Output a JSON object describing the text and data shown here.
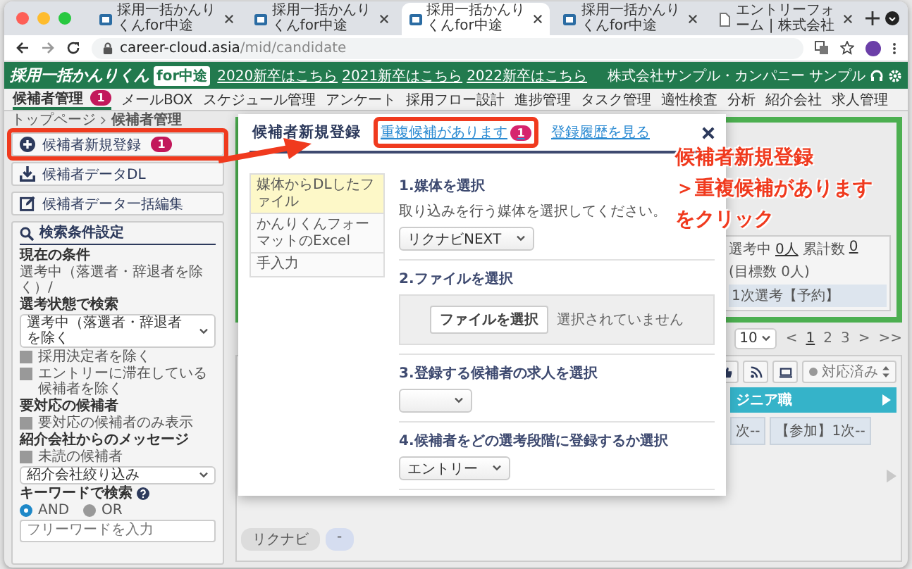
{
  "browser": {
    "tabs": [
      {
        "title": "採用一括かんりくんfor中途",
        "kind": "app",
        "selected": false
      },
      {
        "title": "採用一括かんりくんfor中途",
        "kind": "app",
        "selected": false
      },
      {
        "title": "採用一括かんりくんfor中途",
        "kind": "app",
        "selected": true
      },
      {
        "title": "採用一括かんりくんfor中途",
        "kind": "app",
        "selected": false
      },
      {
        "title": "エントリーフォーム | 株式会社",
        "kind": "doc",
        "selected": false
      }
    ],
    "url": {
      "host": "career-cloud.asia",
      "path": "/mid/candidate"
    }
  },
  "header": {
    "logo": "採用一括かんりくん",
    "logo_badge": "for中途",
    "links": [
      "2020新卒はこちら",
      "2021新卒はこちら",
      "2022新卒はこちら"
    ],
    "company": "株式会社サンプル・カンパニー",
    "user": "サンプル"
  },
  "nav": [
    {
      "label": "候補者管理",
      "badge": "1",
      "selected": true
    },
    {
      "label": "メールBOX",
      "selected": false
    },
    {
      "label": "スケジュール管理",
      "selected": false
    },
    {
      "label": "アンケート",
      "selected": false
    },
    {
      "label": "採用フロー設計",
      "selected": false
    },
    {
      "label": "進捗管理",
      "selected": false
    },
    {
      "label": "タスク管理",
      "selected": false
    },
    {
      "label": "適性検査",
      "selected": false
    },
    {
      "label": "分析",
      "selected": false
    },
    {
      "label": "紹介会社",
      "selected": false
    },
    {
      "label": "求人管理",
      "selected": false
    }
  ],
  "breadcrumb": [
    "トップページ",
    "候補者管理"
  ],
  "sidebar": {
    "actions": [
      {
        "label": "候補者新規登録",
        "kind": "add",
        "badge": "1",
        "highlighted": true
      },
      {
        "label": "候補者データDL",
        "kind": "download",
        "highlighted": false
      },
      {
        "label": "候補者データ一括編集",
        "kind": "edit",
        "highlighted": false
      }
    ],
    "search": {
      "title": "検索条件設定",
      "sections": [
        {
          "label": "現在の条件",
          "items": [
            {
              "kind": "text",
              "label": "選考中（落選者・辞退者を除く）/"
            }
          ]
        },
        {
          "label": "選考状態で検索",
          "items": [
            {
              "kind": "select",
              "label": "選考中（落選者・辞退者を除く"
            },
            {
              "kind": "check",
              "label": "採用決定者を除く",
              "checked": false
            },
            {
              "kind": "check",
              "label": "エントリーに滞在している候補者を除く",
              "checked": false
            }
          ]
        },
        {
          "label": "要対応の候補者",
          "items": [
            {
              "kind": "check",
              "label": "要対応の候補者のみ表示",
              "checked": false
            }
          ]
        },
        {
          "label": "紹介会社からのメッセージ",
          "items": [
            {
              "kind": "check",
              "label": "未読の候補者",
              "checked": false
            },
            {
              "kind": "select",
              "label": "紹介会社絞り込み"
            }
          ]
        }
      ],
      "keyword": {
        "label": "キーワードで検索",
        "radios": [
          {
            "label": "AND",
            "selected": true
          },
          {
            "label": "OR",
            "selected": false
          }
        ],
        "placeholder": "フリーワードを入力"
      }
    }
  },
  "modal": {
    "tabs": [
      {
        "label": "候補者新規登録",
        "selected": true,
        "highlighted": false
      },
      {
        "label": "重複候補があります",
        "badge": "1",
        "selected": false,
        "highlighted": true
      },
      {
        "label": "登録履歴を見る",
        "selected": false,
        "highlighted": false
      }
    ],
    "sources": [
      {
        "label": "媒体からDLしたファイル",
        "selected": true
      },
      {
        "label": "かんりくんフォーマットのExcel",
        "selected": false
      },
      {
        "label": "手入力",
        "selected": false
      }
    ],
    "steps": [
      {
        "kind": "select",
        "title": "1.媒体を選択",
        "note": "取り込みを行う媒体を選択してください。",
        "value": "リクナビNEXT"
      },
      {
        "kind": "file",
        "title": "2.ファイルを選択",
        "button": "ファイルを選択",
        "status": "選択されていません"
      },
      {
        "kind": "select",
        "title": "3.登録する候補者の求人を選択"
      },
      {
        "kind": "select",
        "title": "4.候補者をどの選考段階に登録するか選択",
        "value": "エントリー"
      }
    ]
  },
  "annotation": [
    "候補者新規登録",
    "＞重複候補があります",
    "をクリック"
  ],
  "background": {
    "stats": {
      "active_label": "選考中",
      "active_count": "0人",
      "total_label": "累計数",
      "total_count": "0",
      "target": "(目標数 0人)",
      "stage": "1次選考【予約】"
    },
    "page_size": "10",
    "pager": [
      {
        "label": "<",
        "selected": false
      },
      {
        "label": "1",
        "selected": true
      },
      {
        "label": "2",
        "selected": false
      },
      {
        "label": "3",
        "selected": false
      },
      {
        "label": ">",
        "selected": false
      },
      {
        "label": ">>",
        "selected": false
      }
    ],
    "status_button": "対応済み",
    "column": {
      "title": "ジニア職",
      "cards": [
        "次--",
        "【参加】1次--"
      ]
    },
    "tags": [
      {
        "label": "リクナビ",
        "color": "#dcdcdc"
      },
      {
        "label": "-",
        "color": "#d5ddf0"
      }
    ]
  }
}
